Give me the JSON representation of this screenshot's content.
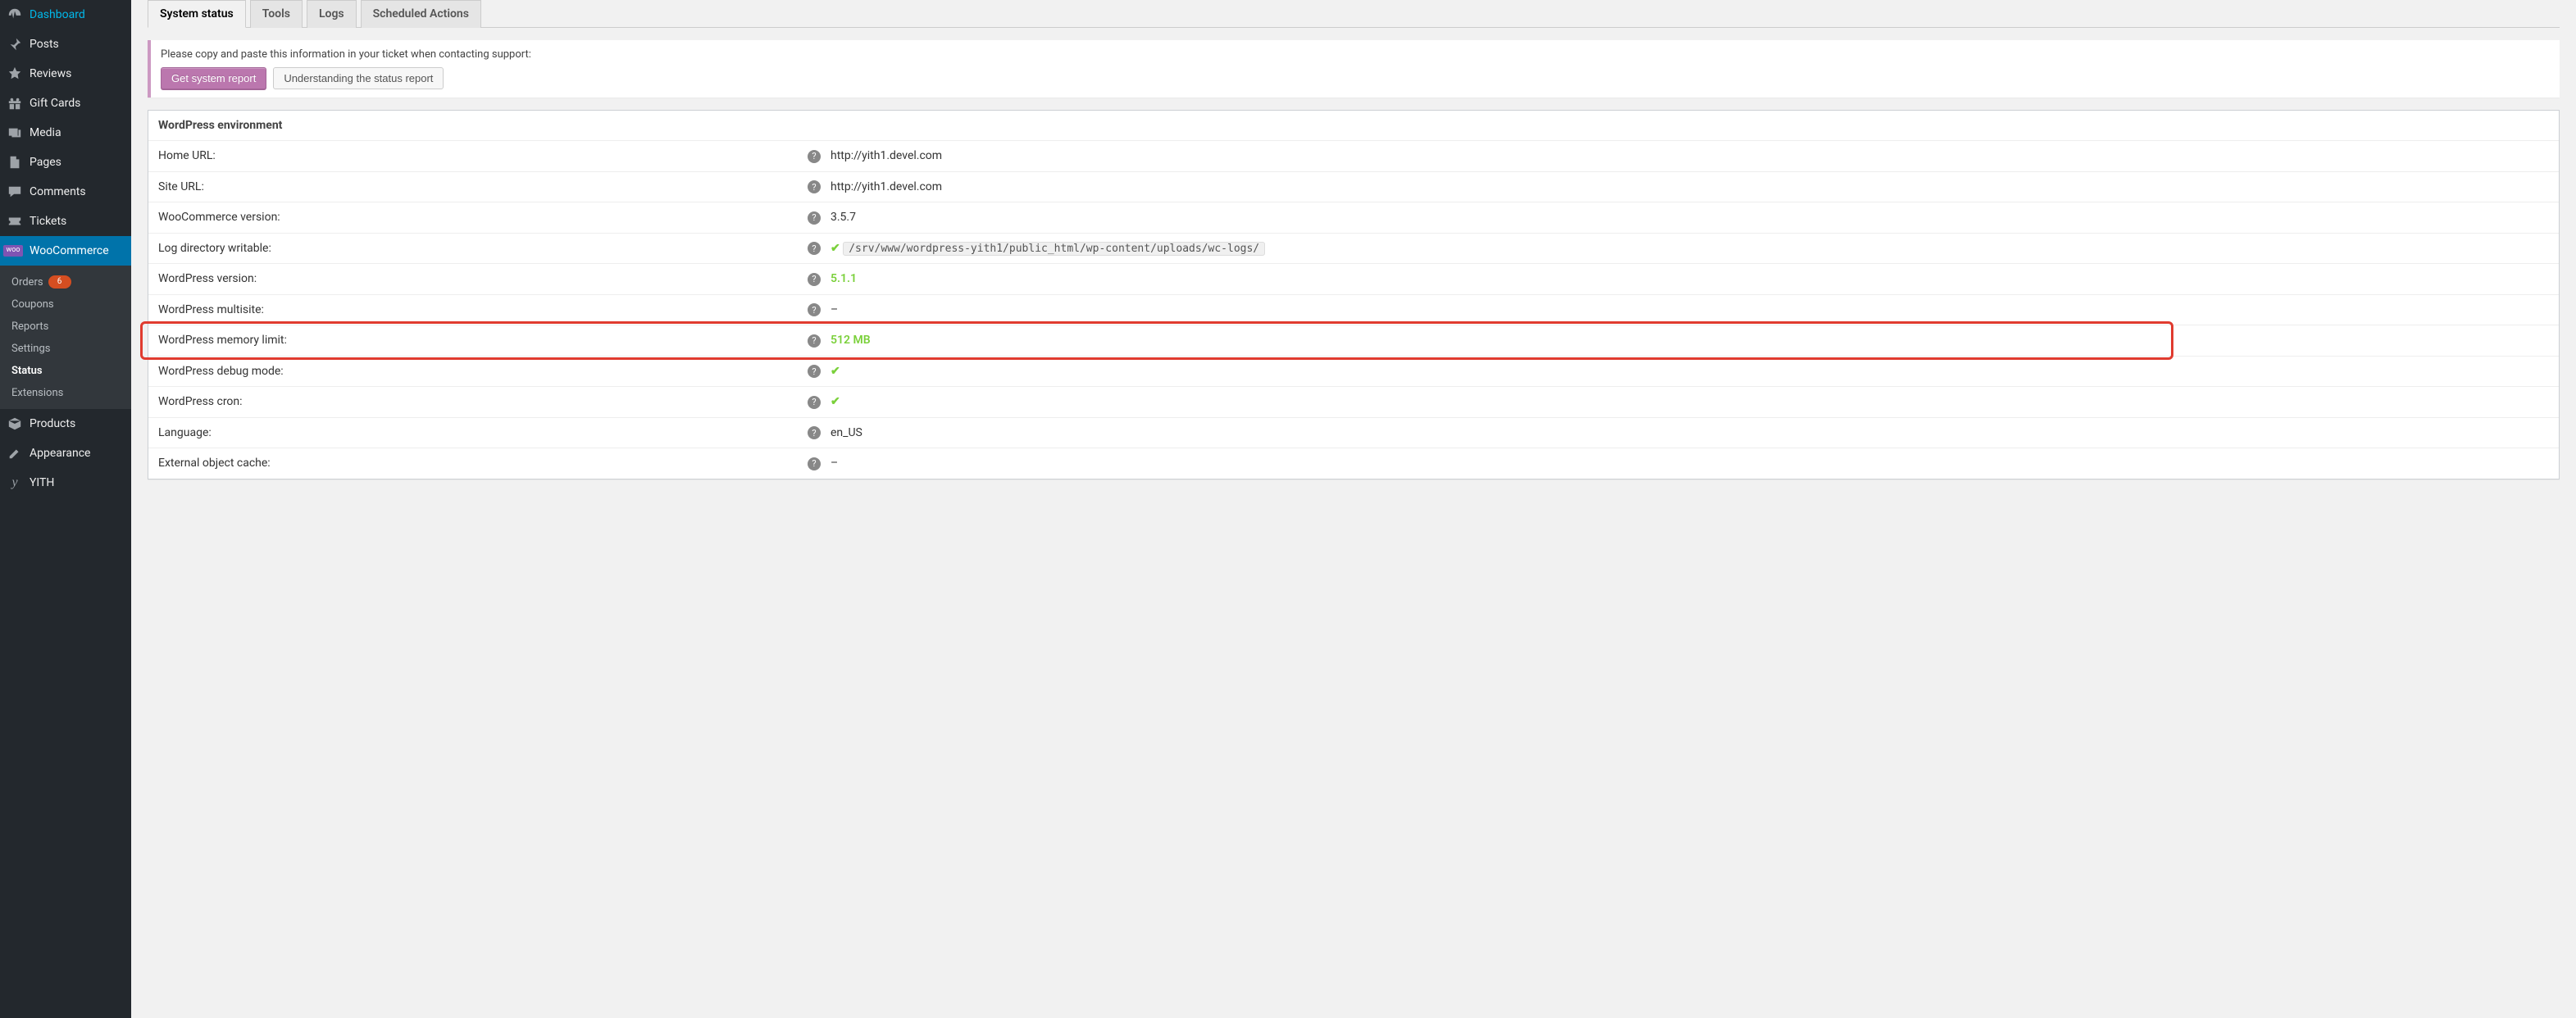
{
  "sidebar": {
    "items": [
      {
        "label": "Dashboard",
        "icon": "dashboard-icon"
      },
      {
        "label": "Posts",
        "icon": "pin-icon"
      },
      {
        "label": "Reviews",
        "icon": "star-icon"
      },
      {
        "label": "Gift Cards",
        "icon": "gift-icon"
      },
      {
        "label": "Media",
        "icon": "media-icon"
      },
      {
        "label": "Pages",
        "icon": "pages-icon"
      },
      {
        "label": "Comments",
        "icon": "comments-icon"
      },
      {
        "label": "Tickets",
        "icon": "tickets-icon"
      },
      {
        "label": "WooCommerce",
        "icon": "woocommerce-icon",
        "current": true
      },
      {
        "label": "Products",
        "icon": "products-icon"
      },
      {
        "label": "Appearance",
        "icon": "appearance-icon"
      },
      {
        "label": "YITH",
        "icon": "yith-icon"
      }
    ],
    "submenu": [
      {
        "label": "Orders",
        "badge": "6"
      },
      {
        "label": "Coupons"
      },
      {
        "label": "Reports"
      },
      {
        "label": "Settings"
      },
      {
        "label": "Status",
        "current": true
      },
      {
        "label": "Extensions"
      }
    ]
  },
  "tabs": [
    {
      "label": "System status",
      "active": true
    },
    {
      "label": "Tools"
    },
    {
      "label": "Logs"
    },
    {
      "label": "Scheduled Actions"
    }
  ],
  "notice": {
    "text": "Please copy and paste this information in your ticket when contacting support:",
    "primary_btn": "Get system report",
    "secondary_btn": "Understanding the status report"
  },
  "panel": {
    "title": "WordPress environment",
    "rows": [
      {
        "label": "Home URL:",
        "value": "http://yith1.devel.com"
      },
      {
        "label": "Site URL:",
        "value": "http://yith1.devel.com"
      },
      {
        "label": "WooCommerce version:",
        "value": "3.5.7"
      },
      {
        "label": "Log directory writable:",
        "value_type": "path",
        "value": "/srv/www/wordpress-yith1/public_html/wp-content/uploads/wc-logs/",
        "check": true
      },
      {
        "label": "WordPress version:",
        "value": "5.1.1",
        "ok": true
      },
      {
        "label": "WordPress multisite:",
        "value": "–"
      },
      {
        "label": "WordPress memory limit:",
        "value": "512 MB",
        "ok": true,
        "highlight": true
      },
      {
        "label": "WordPress debug mode:",
        "value_type": "check"
      },
      {
        "label": "WordPress cron:",
        "value_type": "check"
      },
      {
        "label": "Language:",
        "value": "en_US"
      },
      {
        "label": "External object cache:",
        "value": "–"
      }
    ]
  }
}
